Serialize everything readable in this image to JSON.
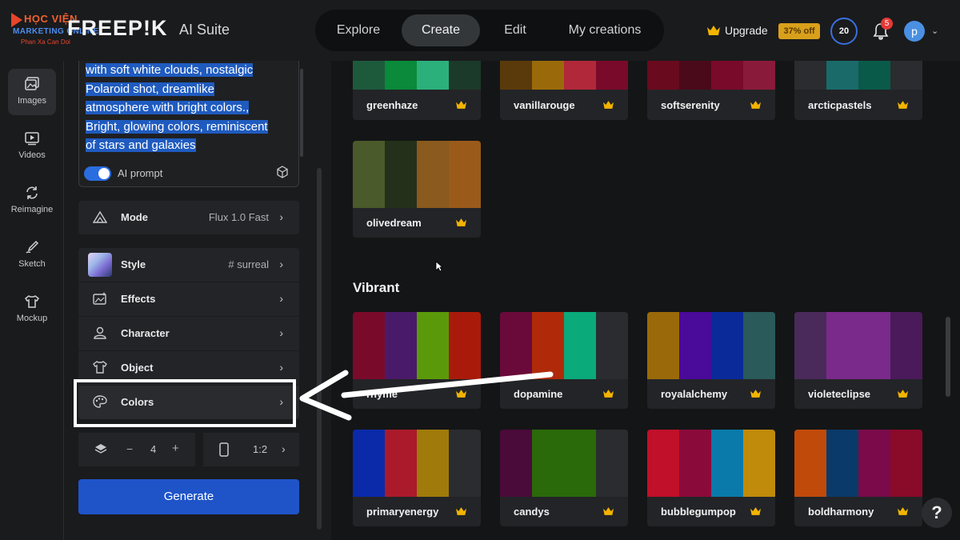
{
  "watermark": {
    "line1": "HỌC VIỆN",
    "line2": "MARKETING ONLINE",
    "line3": "Phan Xa Can Doi"
  },
  "header": {
    "brand": "FREEP!K",
    "suite": "AI Suite",
    "tabs": [
      {
        "label": "Explore",
        "active": false
      },
      {
        "label": "Create",
        "active": true
      },
      {
        "label": "Edit",
        "active": false
      },
      {
        "label": "My creations",
        "active": false
      }
    ],
    "upgrade_label": "Upgrade",
    "discount_badge": "37% off",
    "credits": "20",
    "notifications": "5",
    "avatar_initial": "p"
  },
  "rail": {
    "items": [
      {
        "label": "Images",
        "icon": "images-icon",
        "active": true
      },
      {
        "label": "Videos",
        "icon": "videos-icon",
        "active": false
      },
      {
        "label": "Reimagine",
        "icon": "reimagine-icon",
        "active": false
      },
      {
        "label": "Sketch",
        "icon": "sketch-icon",
        "active": false
      },
      {
        "label": "Mockup",
        "icon": "mockup-icon",
        "active": false
      }
    ]
  },
  "prompt": {
    "lines": [
      "with soft white clouds, nostalgic",
      "Polaroid shot, dreamlike",
      "atmosphere with bright colors.,",
      "Bright, glowing colors, reminiscent",
      "of stars and galaxies"
    ],
    "ai_prompt_label": "AI prompt",
    "ai_prompt_enabled": true
  },
  "settings": {
    "mode": {
      "label": "Mode",
      "value": "Flux 1.0 Fast"
    },
    "style": {
      "label": "Style",
      "value": "# surreal"
    },
    "effects": {
      "label": "Effects"
    },
    "character": {
      "label": "Character"
    },
    "object": {
      "label": "Object"
    },
    "colors": {
      "label": "Colors"
    },
    "count": "4",
    "minus": "−",
    "plus": "+",
    "ratio": "1:2",
    "generate_label": "Generate"
  },
  "palettes": {
    "top_row": [
      {
        "name": "greenhaze",
        "colors": [
          "#1d5a3c",
          "#0a8a3a",
          "#2bb07c",
          "#1c3a2a"
        ]
      },
      {
        "name": "vanillarouge",
        "colors": [
          "#5a3a0a",
          "#9a6a0a",
          "#b0283a",
          "#7a0a2a"
        ]
      },
      {
        "name": "softserenity",
        "colors": [
          "#6a0a1e",
          "#4a0a1a",
          "#7a0a2a",
          "#8a1a3a"
        ]
      },
      {
        "name": "arcticpastels",
        "colors": [
          "#2a2c2f",
          "#1a6a6a",
          "#0a5a4a",
          "#2a2c2f"
        ]
      }
    ],
    "olive": {
      "name": "olivedream",
      "colors": [
        "#4a5a2a",
        "#24301a",
        "#8a5a1e",
        "#9a5a1a"
      ]
    },
    "section_title": "Vibrant",
    "vibrant_row1": [
      {
        "name": "rhyme",
        "colors": [
          "#7a0a2a",
          "#4a1a6a",
          "#5a9a0a",
          "#aa1a0a"
        ]
      },
      {
        "name": "dopamine",
        "colors": [
          "#6a0a3a",
          "#b02a0a",
          "#0aaa7a",
          "#2a2c2f"
        ]
      },
      {
        "name": "royalalchemy",
        "colors": [
          "#9a6a0a",
          "#4a0a9a",
          "#0a2a9a",
          "#2a5a5a"
        ]
      },
      {
        "name": "violeteclipse",
        "colors": [
          "#4a2a5a",
          "#7a2a8a",
          "#7a2a8a",
          "#4a1a5a"
        ]
      }
    ],
    "vibrant_row2": [
      {
        "name": "primaryenergy",
        "colors": [
          "#0a2aaa",
          "#aa1a2a",
          "#a07a0a",
          "#2a2c2f"
        ]
      },
      {
        "name": "candys",
        "colors": [
          "#4a0a3a",
          "#2a6a0a",
          "#2a6a0a",
          "#2a2c2f"
        ]
      },
      {
        "name": "bubblegumpop",
        "colors": [
          "#c0102a",
          "#8a0a3a",
          "#0a7aaa",
          "#c08a0a"
        ]
      },
      {
        "name": "boldharmony",
        "colors": [
          "#c04a0a",
          "#0a3a6a",
          "#7a0a4a",
          "#8a0a2a"
        ]
      }
    ]
  },
  "help_label": "?"
}
